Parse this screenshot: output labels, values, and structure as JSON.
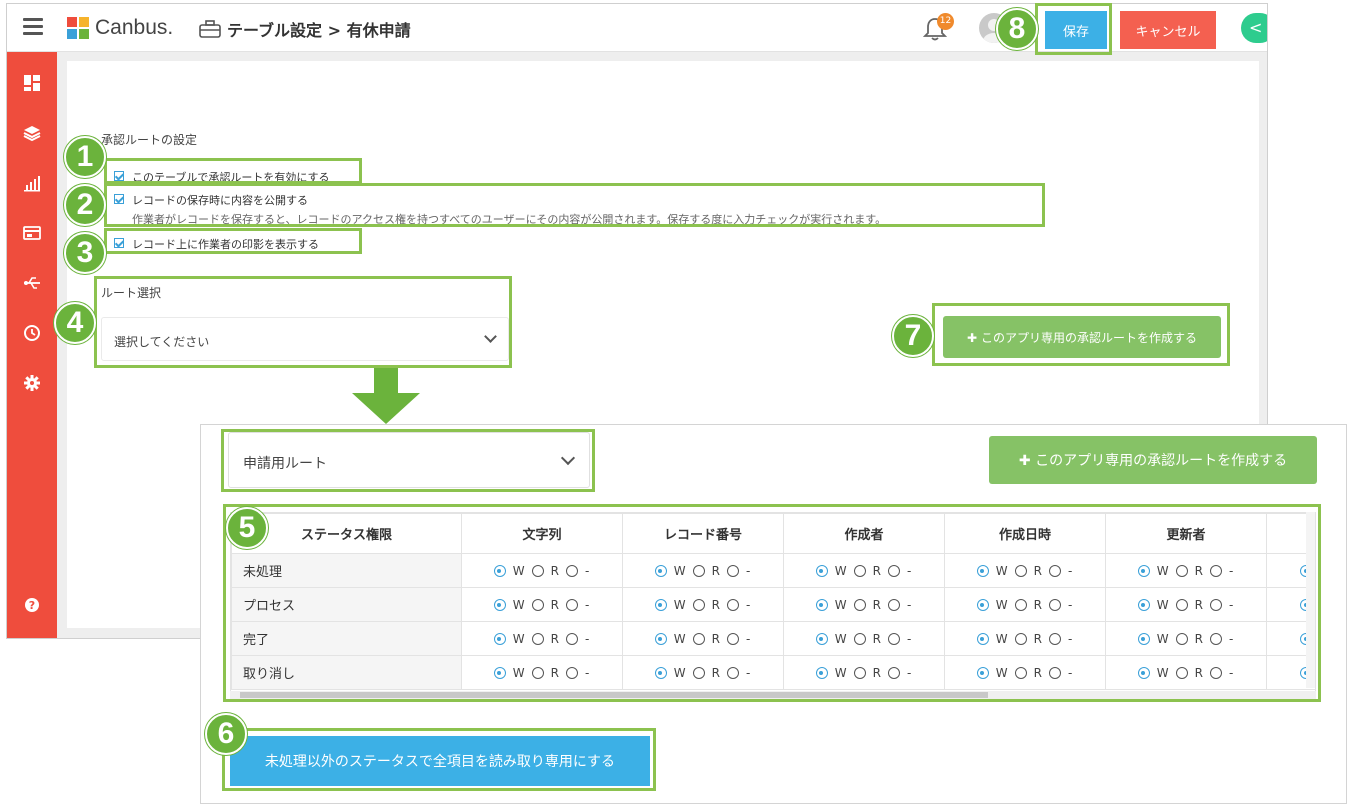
{
  "app": {
    "logo_text": "Canbus.",
    "breadcrumb": "テーブル設定 > 有休申請",
    "notification_count": "12"
  },
  "header": {
    "save_label": "保存",
    "cancel_label": "キャンセル",
    "collapse_glyph": "<"
  },
  "sidebar": {
    "icons": [
      "dashboard-icon",
      "layers-icon",
      "bar-chart-icon",
      "card-icon",
      "usb-icon",
      "history-icon",
      "gear-icon",
      "help-icon"
    ]
  },
  "approval": {
    "section_title": "承認ルートの設定",
    "options": [
      {
        "label": "このテーブルで承認ルートを有効にする",
        "checked": true
      },
      {
        "label": "レコードの保存時に内容を公開する",
        "sub": "作業者がレコードを保存すると、レコードのアクセス権を持つすべてのユーザーにその内容が公開されます。保存する度に入力チェックが実行されます。",
        "checked": true
      },
      {
        "label": "レコード上に作業者の印影を表示する",
        "checked": true
      }
    ],
    "route_label": "ルート選択",
    "route_placeholder": "選択してください",
    "create_route_label": "このアプリ専用の承認ルートを作成する",
    "plus_glyph": "✚"
  },
  "panel": {
    "selected_route": "申請用ルート",
    "create_route_label": "このアプリ専用の承認ルートを作成する",
    "plus_glyph": "✚",
    "table": {
      "corner_header": "ステータス権限",
      "columns": [
        "文字列",
        "レコード番号",
        "作成者",
        "作成日時",
        "更新者"
      ],
      "rows": [
        "未処理",
        "プロセス",
        "完了",
        "取り消し"
      ],
      "perm_letters": [
        "W",
        "R",
        "-"
      ],
      "selected_option": "W"
    },
    "readonly_button": "未処理以外のステータスで全項目を読み取り専用にする"
  },
  "annotations": [
    "1",
    "2",
    "3",
    "4",
    "5",
    "6",
    "7",
    "8"
  ],
  "colors": {
    "accent_green": "#8cc24f",
    "badge_green": "#6bb33c",
    "sidebar_red": "#ef4d3d",
    "save_blue": "#3cb0e6",
    "cancel_red": "#f46050"
  }
}
